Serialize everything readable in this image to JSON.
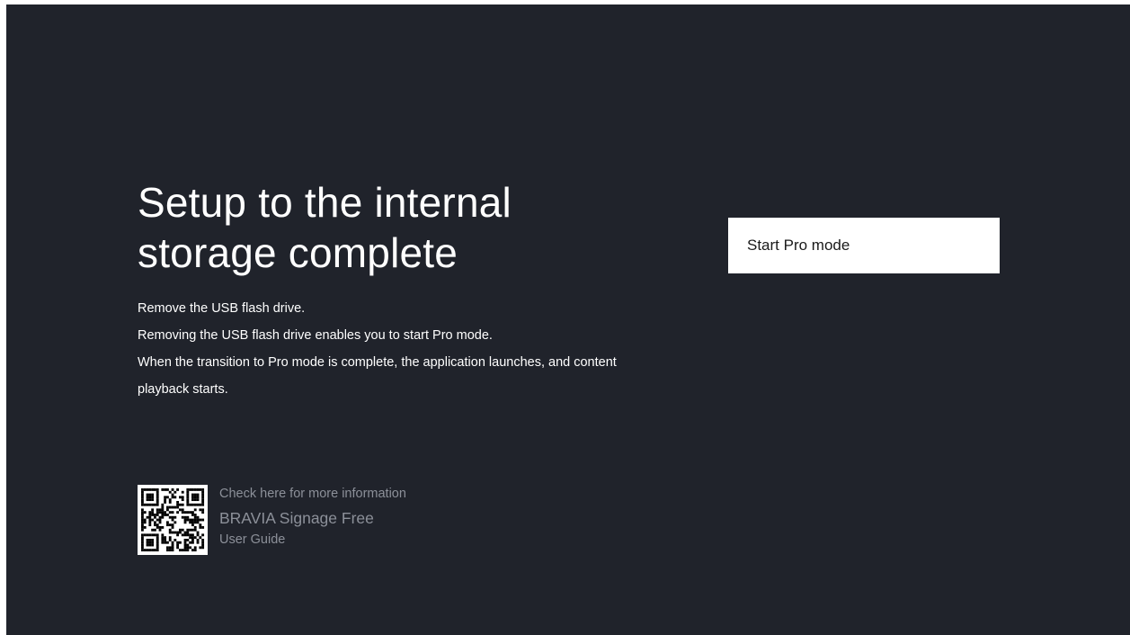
{
  "setup": {
    "title_line1": "Setup to the internal",
    "title_line2": "storage complete",
    "description": [
      "Remove the USB flash drive.",
      "Removing the USB flash drive enables you to start Pro mode.",
      "When the transition to Pro mode is complete, the application launches, and content",
      "playback starts."
    ]
  },
  "info": {
    "check_here": "Check here for more information",
    "product": "BRAVIA Signage Free",
    "guide": "User Guide",
    "qr_icon": "qr-code-icon"
  },
  "actions": {
    "start_pro_mode": "Start Pro mode"
  },
  "colors": {
    "background": "#20232b",
    "text_primary": "#ffffff",
    "text_secondary": "#8c9099",
    "button_bg": "#ffffff",
    "button_text": "#1a1a1a"
  }
}
